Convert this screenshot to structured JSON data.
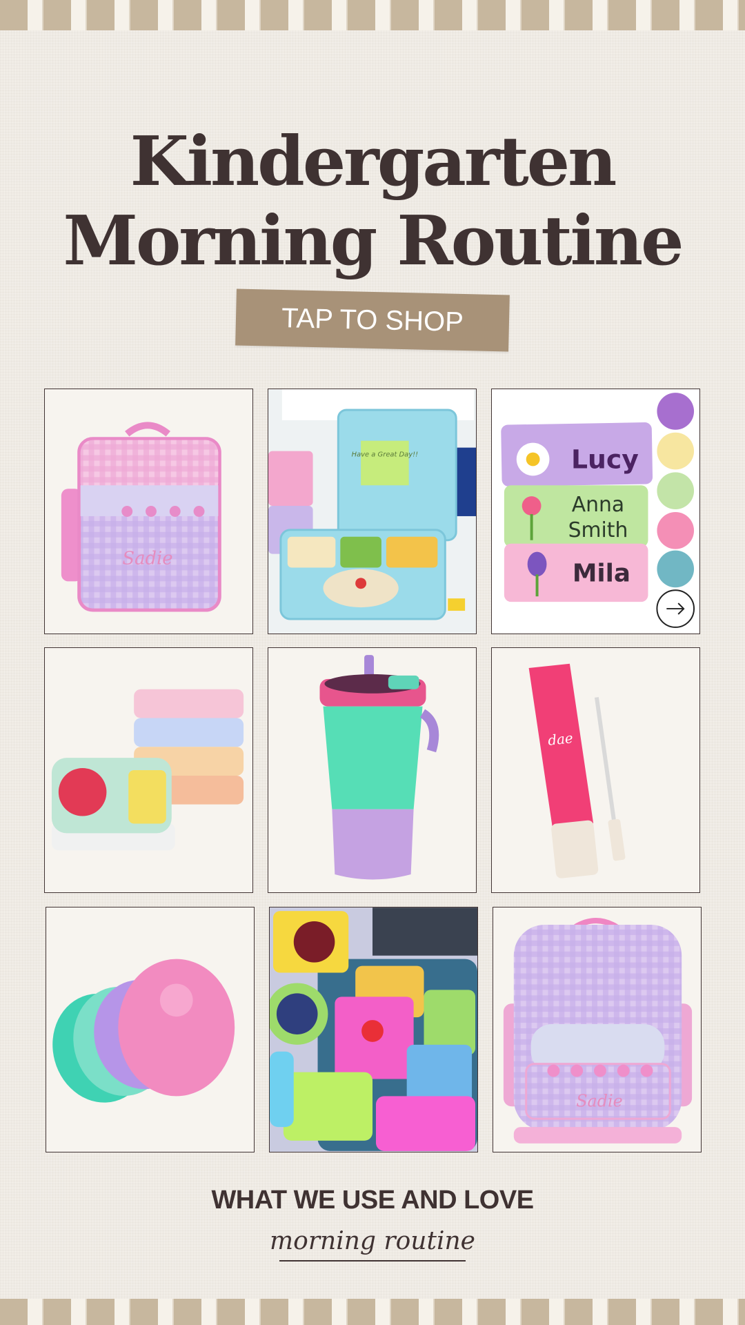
{
  "title": {
    "line1": "Kindergarten",
    "line2": "Morning Routine"
  },
  "cta": {
    "label": "TAP TO SHOP"
  },
  "products": {
    "lunchbox": {
      "name_text": "Sadie"
    },
    "bento": {
      "note_text": "Have a Great Day!!"
    },
    "labels": {
      "names": [
        "Lucy",
        "Anna",
        "Smith",
        "Mila"
      ],
      "arrow_icon": "arrow-right-icon"
    },
    "lip_balm": {
      "brand": "dae"
    },
    "backpack": {
      "name_text": "Sadie"
    }
  },
  "footer": {
    "heading": "WHAT WE USE AND LOVE",
    "script": "morning routine"
  },
  "colors": {
    "text": "#3f3232",
    "button": "#a89278",
    "background": "#f1ede7",
    "stripe": "#c7b79e"
  }
}
